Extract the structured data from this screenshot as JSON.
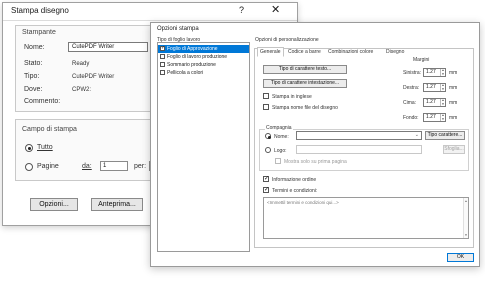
{
  "print_dialog": {
    "title": "Stampa disegno",
    "help_glyph": "?",
    "close_glyph": "✕",
    "printer_section": "Stampante",
    "name_label": "Nome:",
    "name_value": "CutePDF Writer",
    "status_label": "Stato:",
    "status_value": "Ready",
    "type_label": "Tipo:",
    "type_value": "CutePDF Writer",
    "where_label": "Dove:",
    "where_value": "CPW2:",
    "comment_label": "Commento:",
    "range_section": "Campo di stampa",
    "all_label": "Tutto",
    "pages_label": "Pagine",
    "from_label": "da:",
    "from_value": "1",
    "to_label": "per:",
    "options_button": "Opzioni...",
    "preview_button": "Anteprima..."
  },
  "options_dialog": {
    "title": "Opzioni stampa",
    "sheet_type_label": "Tipo di foglio lavoro",
    "sheet_types": [
      {
        "label": "Foglio di Approvazione",
        "checked": true,
        "selected": true
      },
      {
        "label": "Foglio di lavoro produzione",
        "checked": false,
        "selected": false
      },
      {
        "label": "Sommario produzione",
        "checked": false,
        "selected": false
      },
      {
        "label": "Pellicola a colori",
        "checked": false,
        "selected": false
      }
    ],
    "custom_options_label": "Opzioni di personalizzazione",
    "tabs": [
      "Generale",
      "Codice a barre",
      "Combinazioni colore",
      "Disegno"
    ],
    "active_tab": "Generale",
    "text_font_button": "Tipo di carattere testo...",
    "header_font_button": "Tipo di carattere intestazione...",
    "print_english": "Stampa in inglese",
    "print_filename": "Stampa nome file del disegno",
    "margins_label": "Margini",
    "margins": [
      {
        "label": "Sinistra:",
        "value": "1.27"
      },
      {
        "label": "Destra:",
        "value": "1.27"
      },
      {
        "label": "Cima:",
        "value": "1.27"
      },
      {
        "label": "Fondo:",
        "value": "1.27"
      }
    ],
    "unit": "mm",
    "company_label": "Compagnia",
    "company_name_label": "Nome:",
    "font_type_button": "Tipo carattere...",
    "clear_button": "Elimina",
    "logo_label": "Logo:",
    "browse_button": "Sfoglia...",
    "first_page_only": "Mostra solo su prima pagina",
    "order_info": "Informazione ordine",
    "terms": "Termini e condizioni:",
    "terms_placeholder": "<Immettil termini e condizioni qui...>",
    "ok_button": "OK"
  }
}
